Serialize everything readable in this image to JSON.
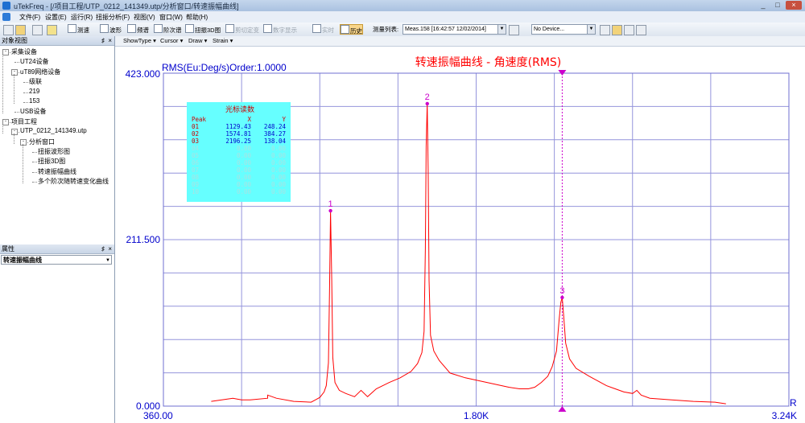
{
  "window": {
    "title": "uTekFreq - [/项目工程/UTP_0212_141349.utp/分析窗口/转速振幅曲线]",
    "controls": [
      "_",
      "□",
      "×"
    ]
  },
  "menu": [
    "文件(F)",
    "设置(E)",
    "运行(R)",
    "扭振分析(F)",
    "视图(V)",
    "窗口(W)",
    "帮助(H)"
  ],
  "toolbar": {
    "buttons": [
      "测速",
      "波形",
      "频谱",
      "阶次谱",
      "扭振3D图",
      "剪切定变",
      "数字显示",
      "实时",
      "历史"
    ],
    "meas_label": "测量列表:",
    "meas_value": "Meas.158 [16:42:57 12/02/2014]",
    "device_value": "No Device..."
  },
  "object_view": {
    "title": "对象视图",
    "pin": "♯",
    "close": "×",
    "tree": [
      {
        "label": "采集设备",
        "level": 0,
        "expander": "-"
      },
      {
        "label": "UT24设备",
        "level": 1
      },
      {
        "label": "uT89网络设备",
        "level": 1,
        "expander": "-"
      },
      {
        "label": "级联",
        "level": 2
      },
      {
        "label": "219",
        "level": 2
      },
      {
        "label": "153",
        "level": 2
      },
      {
        "label": "USB设备",
        "level": 1
      },
      {
        "label": "项目工程",
        "level": 0,
        "expander": "-"
      },
      {
        "label": "UTP_0212_141349.utp",
        "level": 1,
        "expander": "-"
      },
      {
        "label": "分析窗口",
        "level": 2,
        "expander": "-"
      },
      {
        "label": "扭振波形图",
        "level": 3
      },
      {
        "label": "扭振3D图",
        "level": 3
      },
      {
        "label": "转速振幅曲线",
        "level": 3
      },
      {
        "label": "多个阶次随转速变化曲线",
        "level": 3
      }
    ]
  },
  "properties": {
    "title": "属性",
    "pin": "♯",
    "close": "×",
    "selected": "转速振幅曲线"
  },
  "chart_toolbar": [
    "ShowType ▾",
    "Cursor ▾",
    "Draw ▾",
    "Strain ▾"
  ],
  "chart_data": {
    "type": "line",
    "title": "转速振幅曲线 - 角速度(RMS)",
    "ylabel": "RMS(Eu:Deg/s)",
    "order_label": "Order:1.0000",
    "xlabel": "R",
    "xlim": [
      360,
      3240
    ],
    "ylim": [
      0,
      423
    ],
    "x_ticks": [
      "360.00",
      "1.80K",
      "3.24K"
    ],
    "y_ticks": [
      "0.000",
      "211.500",
      "423.000"
    ],
    "cursor_x": 2196.25,
    "colors": {
      "line": "#ff0000",
      "marker": "#cc00cc",
      "title": "#ff0000",
      "axis": "#0000cc",
      "table_bg": "#66ffff"
    },
    "series": [
      {
        "x": [
          580,
          680,
          720,
          760,
          840,
          840,
          880,
          960,
          1040,
          1060,
          1080,
          1100,
          1110,
          1120,
          1125,
          1129.43,
          1135,
          1140,
          1150,
          1170,
          1200,
          1240,
          1270,
          1300,
          1340,
          1400,
          1450,
          1500,
          1530,
          1550,
          1560,
          1566,
          1570,
          1574.81,
          1579,
          1583,
          1590,
          1605,
          1630,
          1680,
          1750,
          1850,
          1950,
          2000,
          2040,
          2070,
          2100,
          2130,
          2150,
          2170,
          2182,
          2190,
          2196.25,
          2203,
          2212,
          2230,
          2260,
          2320,
          2400,
          2480,
          2520,
          2540,
          2560,
          2600,
          2700,
          2800,
          2900,
          2950
        ],
        "y": [
          6,
          10,
          8,
          8,
          10,
          14,
          10,
          6,
          5,
          8,
          11,
          18,
          26,
          55,
          150,
          248.24,
          160,
          62,
          30,
          20,
          16,
          12,
          20,
          12,
          22,
          30,
          36,
          44,
          54,
          68,
          95,
          200,
          330,
          384.27,
          300,
          160,
          90,
          70,
          58,
          42,
          36,
          30,
          24,
          22,
          22,
          24,
          30,
          38,
          50,
          70,
          110,
          132,
          138.04,
          115,
          80,
          60,
          48,
          38,
          26,
          18,
          16,
          20,
          14,
          10,
          8,
          6,
          5,
          3
        ]
      }
    ],
    "peaks": [
      {
        "label": "1",
        "x": 1129.43,
        "y": 248.24
      },
      {
        "label": "2",
        "x": 1574.81,
        "y": 384.27
      },
      {
        "label": "3",
        "x": 2196.25,
        "y": 138.04
      }
    ],
    "cursor_table": {
      "title": "光标读数",
      "headers": [
        "Peak",
        "X",
        "Y"
      ],
      "rows": [
        [
          "01",
          "1129.43",
          "248.24"
        ],
        [
          "02",
          "1574.81",
          "384.27"
        ],
        [
          "03",
          "2196.25",
          "138.04"
        ],
        [
          "04",
          "0.00",
          "0.00"
        ],
        [
          "05",
          "0.00",
          "0.00"
        ],
        [
          "06",
          "0.00",
          "0.00"
        ],
        [
          "07",
          "0.00",
          "0.00"
        ],
        [
          "08",
          "0.00",
          "0.00"
        ],
        [
          "09",
          "0.00",
          "0.00"
        ],
        [
          "10",
          "0.00",
          "0.00"
        ]
      ]
    }
  }
}
